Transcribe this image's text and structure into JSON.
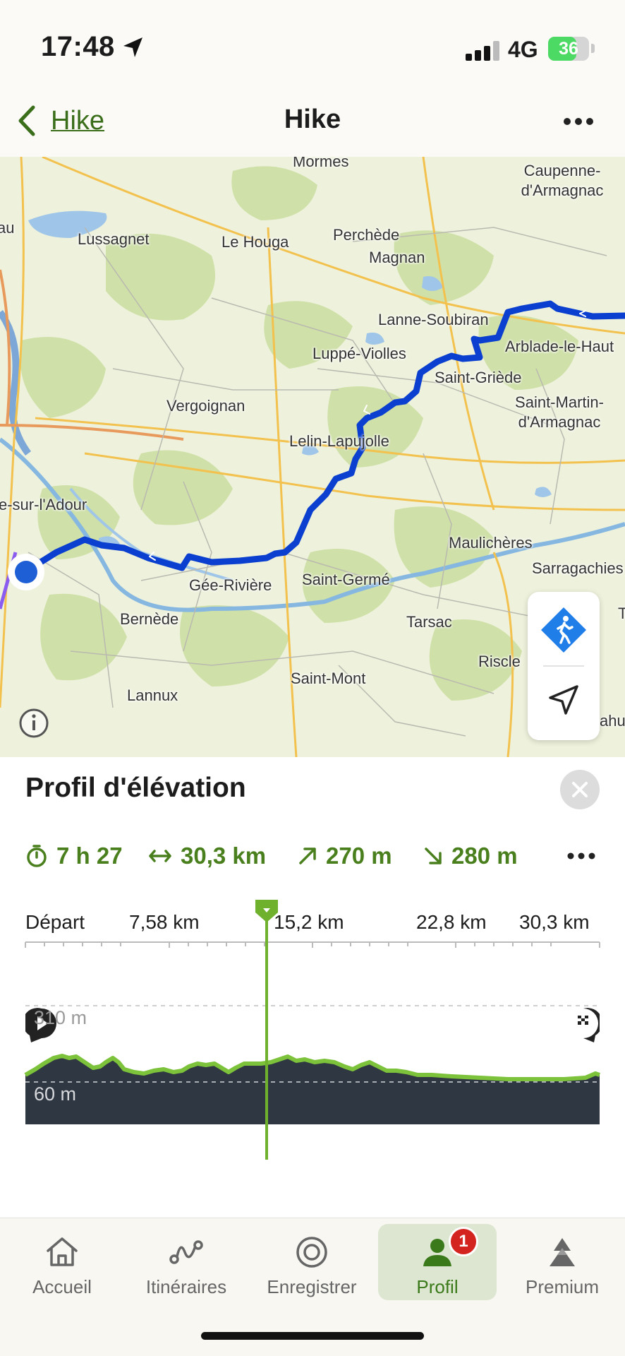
{
  "status_bar": {
    "time": "17:48",
    "network": "4G",
    "battery": "36"
  },
  "header": {
    "back_label": "Hike",
    "title": "Hike"
  },
  "map": {
    "places": [
      "Mormes",
      "Caupenne-d'Armagnac",
      "Lussagnet",
      "Le Houga",
      "Perchède",
      "Magnan",
      "Lanne-Soubiran",
      "Arblade-le-Haut",
      "Luppé-Violles",
      "Saint-Griède",
      "Vergoignan",
      "Saint-Martin-d'Armagnac",
      "Lelin-Lapujolle",
      "e-sur-l'Adour",
      "Maulichères",
      "Sarragachies",
      "Gée-Rivière",
      "Saint-Germé",
      "Bernède",
      "Tarsac",
      "Riscle",
      "Saint-Mont",
      "Lannux",
      "au",
      "T",
      "ahu"
    ]
  },
  "panel": {
    "title": "Profil d'élévation",
    "stats": {
      "duration": "7 h 27",
      "distance": "30,3 km",
      "ascent": "270 m",
      "descent": "280 m"
    },
    "distance_ticks": [
      "Départ",
      "7,58 km",
      "15,2 km",
      "22,8 km",
      "30,3 km"
    ],
    "elevation_labels": {
      "high": "310 m",
      "low": "60 m"
    }
  },
  "tabs": [
    {
      "label": "Accueil",
      "icon": "home-icon"
    },
    {
      "label": "Itinéraires",
      "icon": "route-icon"
    },
    {
      "label": "Enregistrer",
      "icon": "record-icon"
    },
    {
      "label": "Profil",
      "icon": "profile-icon",
      "badge": "1",
      "active": true
    },
    {
      "label": "Premium",
      "icon": "premium-icon"
    }
  ],
  "colors": {
    "accent": "#4a7f1e",
    "route": "#0a3fcf",
    "profile_line": "#7cc23a",
    "profile_fill": "#2f3742",
    "badge": "#d42420"
  }
}
